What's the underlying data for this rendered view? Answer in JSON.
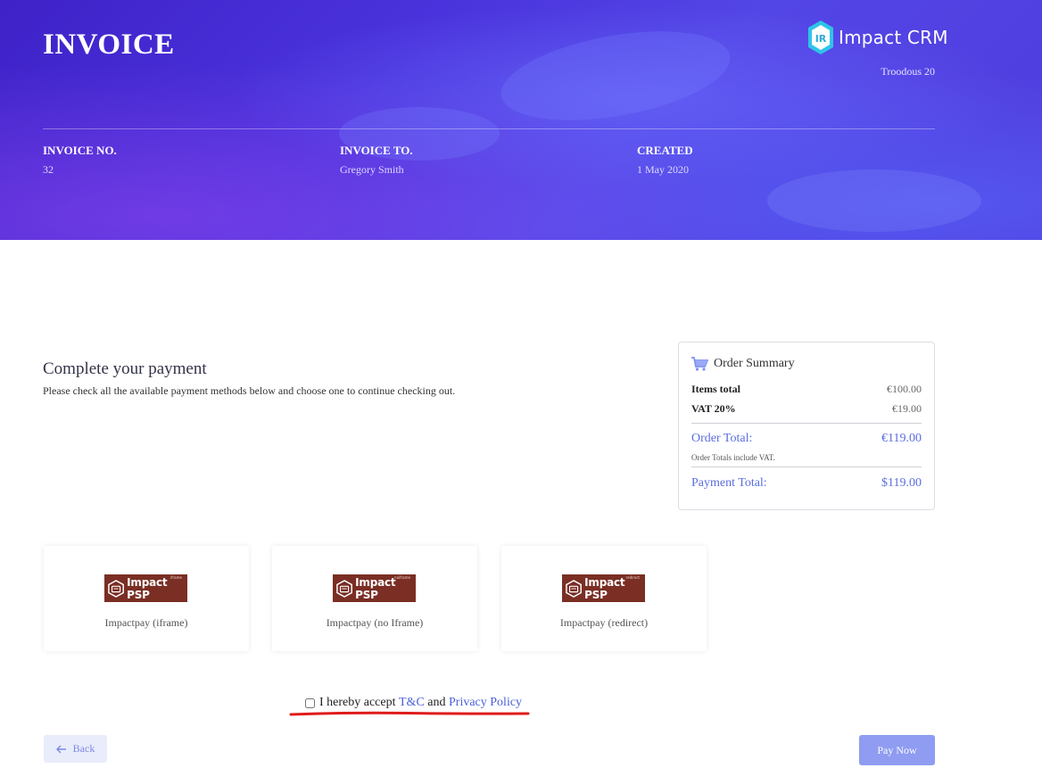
{
  "header": {
    "title": "INVOICE",
    "brand": "Impact CRM",
    "brand_mark": "IR",
    "company": "Troodous 20",
    "meta": [
      {
        "label": "INVOICE NO.",
        "value": "32"
      },
      {
        "label": "INVOICE TO.",
        "value": "Gregory Smith"
      },
      {
        "label": "CREATED",
        "value": "1 May 2020"
      }
    ]
  },
  "payment": {
    "title": "Complete your payment",
    "description": "Please check all the available payment methods below and choose one to continue checking out."
  },
  "summary": {
    "heading": "Order Summary",
    "items_total_label": "Items total",
    "items_total_value": "€100.00",
    "vat_label": "VAT 20%",
    "vat_value": "€19.00",
    "order_total_label": "Order Total:",
    "order_total_value": "€119.00",
    "note": "Order Totals include VAT.",
    "payment_total_label": "Payment Total:",
    "payment_total_value": "$119.00"
  },
  "methods": [
    {
      "logo_text": "Impact PSP",
      "tag": "iframe",
      "label": "Impactpay (iframe)"
    },
    {
      "logo_text": "Impact PSP",
      "tag": "noiframe",
      "label": "Impactpay (no Iframe)"
    },
    {
      "logo_text": "Impact PSP",
      "tag": "redirect",
      "label": "Impactpay (redirect)"
    }
  ],
  "terms": {
    "prefix": "I hereby accept",
    "tc": "T&C",
    "and": "and",
    "privacy": "Privacy Policy"
  },
  "buttons": {
    "back": "Back",
    "pay": "Pay Now"
  },
  "colors": {
    "accent": "#5b6ee1",
    "pay_button": "#8f9cf1",
    "header": "#4a33dc",
    "psp_logo": "#7a2e24",
    "highlight": "#e01b1b"
  }
}
